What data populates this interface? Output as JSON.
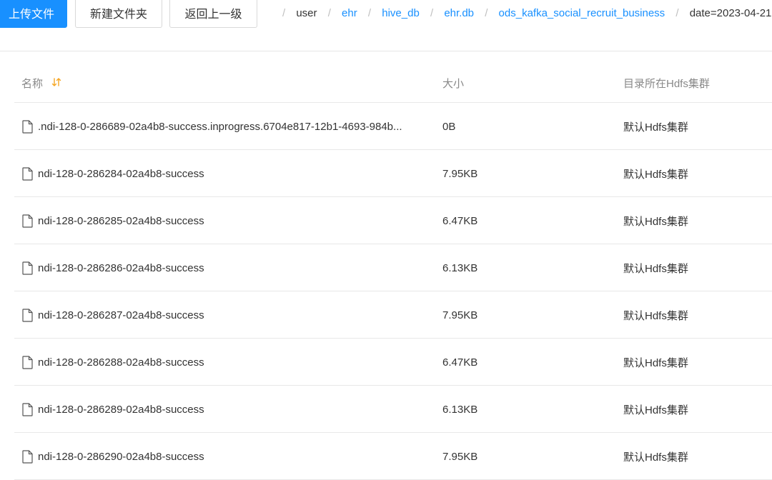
{
  "toolbar": {
    "upload_label": "上传文件",
    "new_folder_label": "新建文件夹",
    "back_label": "返回上一级"
  },
  "breadcrumb": [
    {
      "label": "user",
      "link": false
    },
    {
      "label": "ehr",
      "link": true
    },
    {
      "label": "hive_db",
      "link": true
    },
    {
      "label": "ehr.db",
      "link": true
    },
    {
      "label": "ods_kafka_social_recruit_business",
      "link": true
    },
    {
      "label": "date=2023-04-21",
      "link": false
    }
  ],
  "table": {
    "headers": {
      "name": "名称",
      "size": "大小",
      "cluster": "目录所在Hdfs集群"
    },
    "rows": [
      {
        "name": ".ndi-128-0-286689-02a4b8-success.inprogress.6704e817-12b1-4693-984b...",
        "size": "0B",
        "cluster": "默认Hdfs集群"
      },
      {
        "name": "ndi-128-0-286284-02a4b8-success",
        "size": "7.95KB",
        "cluster": "默认Hdfs集群"
      },
      {
        "name": "ndi-128-0-286285-02a4b8-success",
        "size": "6.47KB",
        "cluster": "默认Hdfs集群"
      },
      {
        "name": "ndi-128-0-286286-02a4b8-success",
        "size": "6.13KB",
        "cluster": "默认Hdfs集群"
      },
      {
        "name": "ndi-128-0-286287-02a4b8-success",
        "size": "7.95KB",
        "cluster": "默认Hdfs集群"
      },
      {
        "name": "ndi-128-0-286288-02a4b8-success",
        "size": "6.47KB",
        "cluster": "默认Hdfs集群"
      },
      {
        "name": "ndi-128-0-286289-02a4b8-success",
        "size": "6.13KB",
        "cluster": "默认Hdfs集群"
      },
      {
        "name": "ndi-128-0-286290-02a4b8-success",
        "size": "7.95KB",
        "cluster": "默认Hdfs集群"
      }
    ]
  },
  "icons": {
    "sort": "sort-icon",
    "file": "file-icon"
  },
  "colors": {
    "primary": "#1890ff",
    "sort_accent": "#f5a623",
    "header_text": "#888888",
    "border": "#e8e8e8"
  }
}
